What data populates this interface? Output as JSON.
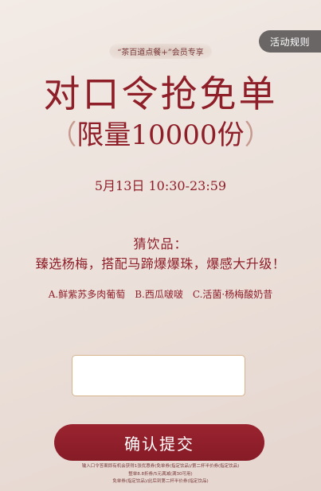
{
  "header": {
    "rules_label": "活动规则",
    "member_badge": "“茶百道点餐+”会员专享"
  },
  "hero": {
    "title": "对口令抢免单",
    "subtitle_open": "（",
    "subtitle_text": "限量10000份",
    "subtitle_close": "）",
    "date": "5月13日 10:30-23:59"
  },
  "question": {
    "label": "猜饮品：",
    "text": "臻选杨梅，搭配马蹄爆爆珠，爆感大升级！",
    "options": [
      "A.鲜紫苏多肉葡萄",
      "B.西瓜啵啵",
      "C.活菌·杨梅酸奶昔"
    ]
  },
  "form": {
    "answer_value": "",
    "answer_placeholder": "",
    "confirm_label": "确认提交"
  },
  "footnotes": [
    "输入口令答案即有机会获得1张优惠券(免单券(指定饮品)/第二杯半价券(指定饮品)",
    "整单8.8折券/5元满减(满30可用)",
    "免单券(指定饮品)/此后到第二杯半价券(指定饮品)"
  ]
}
